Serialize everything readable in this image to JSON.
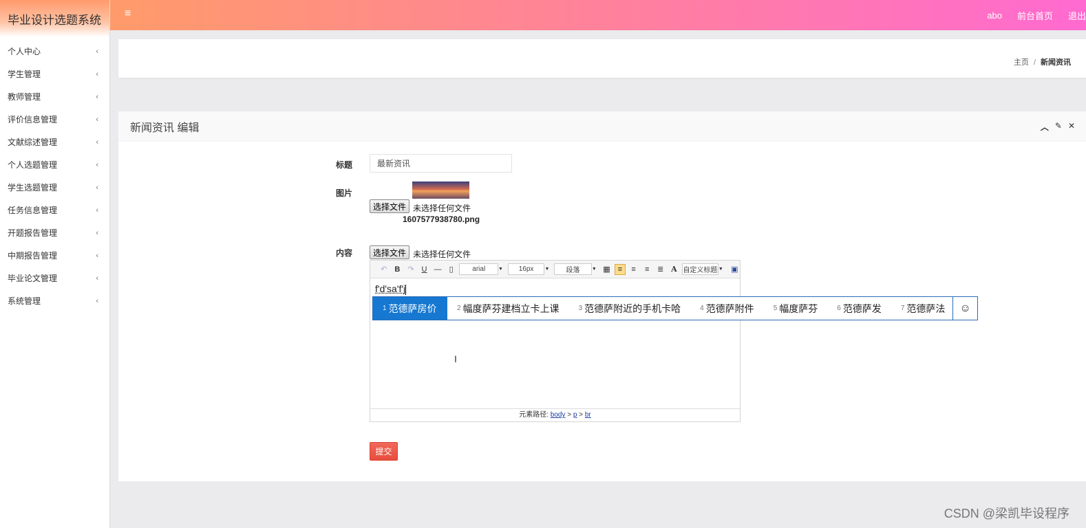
{
  "app": {
    "title": "毕业设计选题系统"
  },
  "sidebar": {
    "items": [
      {
        "label": "个人中心"
      },
      {
        "label": "学生管理"
      },
      {
        "label": "教师管理"
      },
      {
        "label": "评价信息管理"
      },
      {
        "label": "文献综述管理"
      },
      {
        "label": "个人选题管理"
      },
      {
        "label": "学生选题管理"
      },
      {
        "label": "任务信息管理"
      },
      {
        "label": "开题报告管理"
      },
      {
        "label": "中期报告管理"
      },
      {
        "label": "毕业论文管理"
      },
      {
        "label": "系统管理"
      }
    ],
    "chevron": "‹"
  },
  "topbar": {
    "menu_icon": "≡",
    "user": "abo",
    "home": "前台首页",
    "logout": "退出"
  },
  "breadcrumb": {
    "home": "主页",
    "sep": "/",
    "current": "新闻资讯"
  },
  "panel": {
    "title": "新闻资讯 编辑"
  },
  "form": {
    "title_label": "标题",
    "title_value": "最新资讯",
    "image_label": "图片",
    "choose_file": "选择文件",
    "no_file": "未选择任何文件",
    "image_filename": "1607577938780.png",
    "content_label": "内容",
    "submit": "提交"
  },
  "editor": {
    "font_family": "arial",
    "font_size": "16px",
    "paragraph": "段落",
    "custom_title": "自定义标题",
    "typed_text": "f'd'sa'f'j",
    "path_label": "元素路径:",
    "path": [
      "body",
      "p",
      "br"
    ]
  },
  "ime": {
    "candidates": [
      {
        "n": "1",
        "text": "范德萨房价"
      },
      {
        "n": "2",
        "text": "幅度萨芬建档立卡上课"
      },
      {
        "n": "3",
        "text": "范德萨附近的手机卡哈"
      },
      {
        "n": "4",
        "text": "范德萨附件"
      },
      {
        "n": "5",
        "text": "幅度萨芬"
      },
      {
        "n": "6",
        "text": "范德萨发"
      },
      {
        "n": "7",
        "text": "范德萨法"
      }
    ],
    "emoji": "☺"
  },
  "watermark": "CSDN @梁凯毕设程序"
}
